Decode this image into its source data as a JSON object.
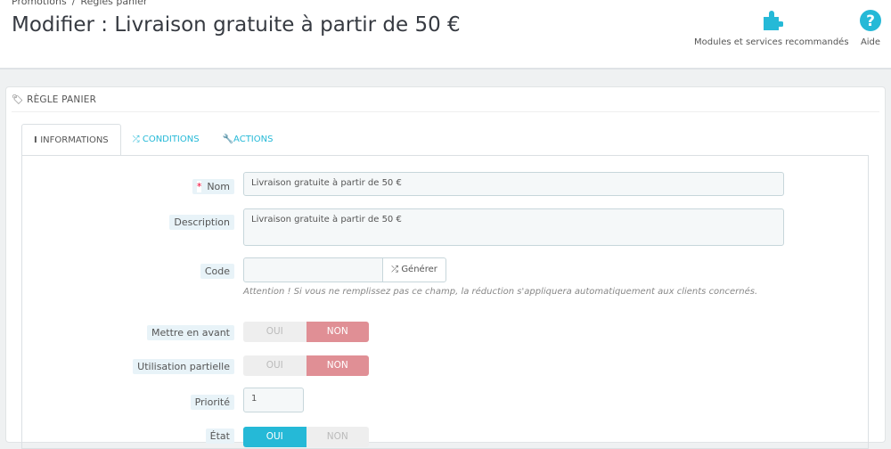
{
  "breadcrumb": [
    "Promotions",
    "/",
    "Règles panier"
  ],
  "title": "Modifier : Livraison gratuite à partir de 50 €",
  "header_buttons": {
    "modules": "Modules et services recommandés",
    "help": "Aide"
  },
  "panel_title": "Règle panier",
  "tabs": [
    {
      "label": "Informations",
      "icon": "info-icon"
    },
    {
      "label": "Conditions",
      "icon": "shuffle-icon"
    },
    {
      "label": "Actions",
      "icon": "wrench-icon"
    }
  ],
  "form": {
    "name_label": "Nom",
    "name_value": "Livraison gratuite à partir de 50 €",
    "desc_label": "Description",
    "desc_value": "Livraison gratuite à partir de 50 €",
    "code_label": "Code",
    "code_value": "",
    "generate": "Générer",
    "code_hint": "Attention ! Si vous ne remplissez pas ce champ, la réduction s'appliquera automatiquement aux clients concernés.",
    "highlight_label": "Mettre en avant",
    "partial_label": "Utilisation partielle",
    "priority_label": "Priorité",
    "priority_value": "1",
    "status_label": "État",
    "yes": "OUI",
    "no": "NON",
    "highlight": "NON",
    "partial": "NON",
    "status": "OUI"
  },
  "colors": {
    "accent": "#25b9d7",
    "no_active": "#e08f95"
  }
}
